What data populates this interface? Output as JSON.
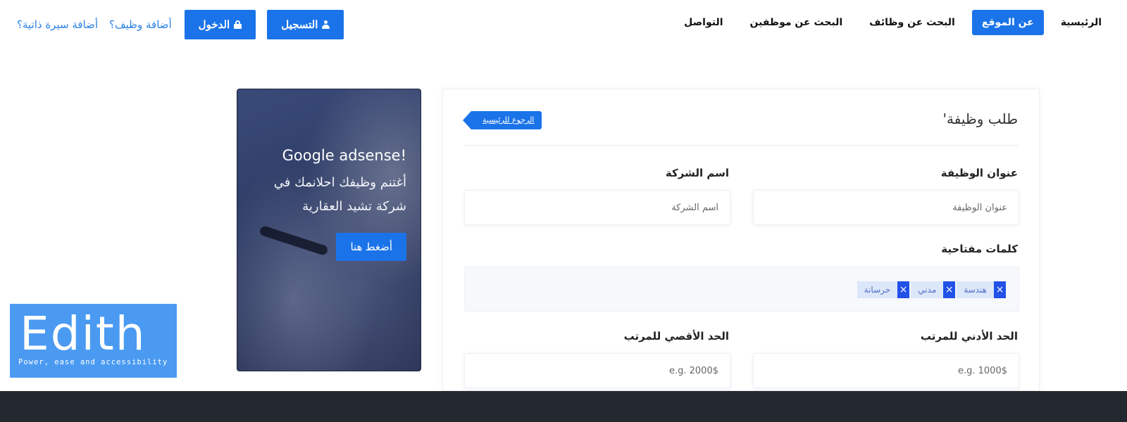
{
  "nav": {
    "items": [
      {
        "label": "الرئيسية",
        "active": false
      },
      {
        "label": "عن الموقع",
        "active": true
      },
      {
        "label": "البحث عن وظائف",
        "active": false
      },
      {
        "label": "البحث عن موظفين",
        "active": false
      },
      {
        "label": "التواصل",
        "active": false
      }
    ],
    "register_label": "التسجيل",
    "login_label": "الدخول",
    "add_job_label": "أضافة وظيف؟",
    "add_cv_label": "أضافة سيرة ذاتية؟",
    "accent_color": "#1a73e8"
  },
  "ad": {
    "title": "Google adsense!",
    "text": "أغتنم وظيفك احلانمك في شركة تشيد العقارية",
    "button_label": "أضغط هنا"
  },
  "form": {
    "page_title": "'طلب وظيفة",
    "back_label": "الرجوع للرئيسية",
    "job_title_label": "عنوان الوظيفة",
    "job_title_placeholder": "عنوان الوظيفة",
    "company_label": "اسم الشركة",
    "company_placeholder": "اسم الشركة",
    "keywords_label": "كلمات مفتاحية",
    "tags": [
      {
        "text": "هندسة",
        "remove": "×"
      },
      {
        "text": "مدني",
        "remove": "×"
      },
      {
        "text": "خرسانة",
        "remove": "×"
      }
    ],
    "min_salary_label": "الحد الأدني للمرتب",
    "min_salary_placeholder": "e.g. 1000$",
    "max_salary_label": "الحد الأقصي للمرتب",
    "max_salary_placeholder": "e.g. 2000$"
  },
  "logo": {
    "word": "Edith",
    "tagline": "Power, ease and accessibility"
  }
}
